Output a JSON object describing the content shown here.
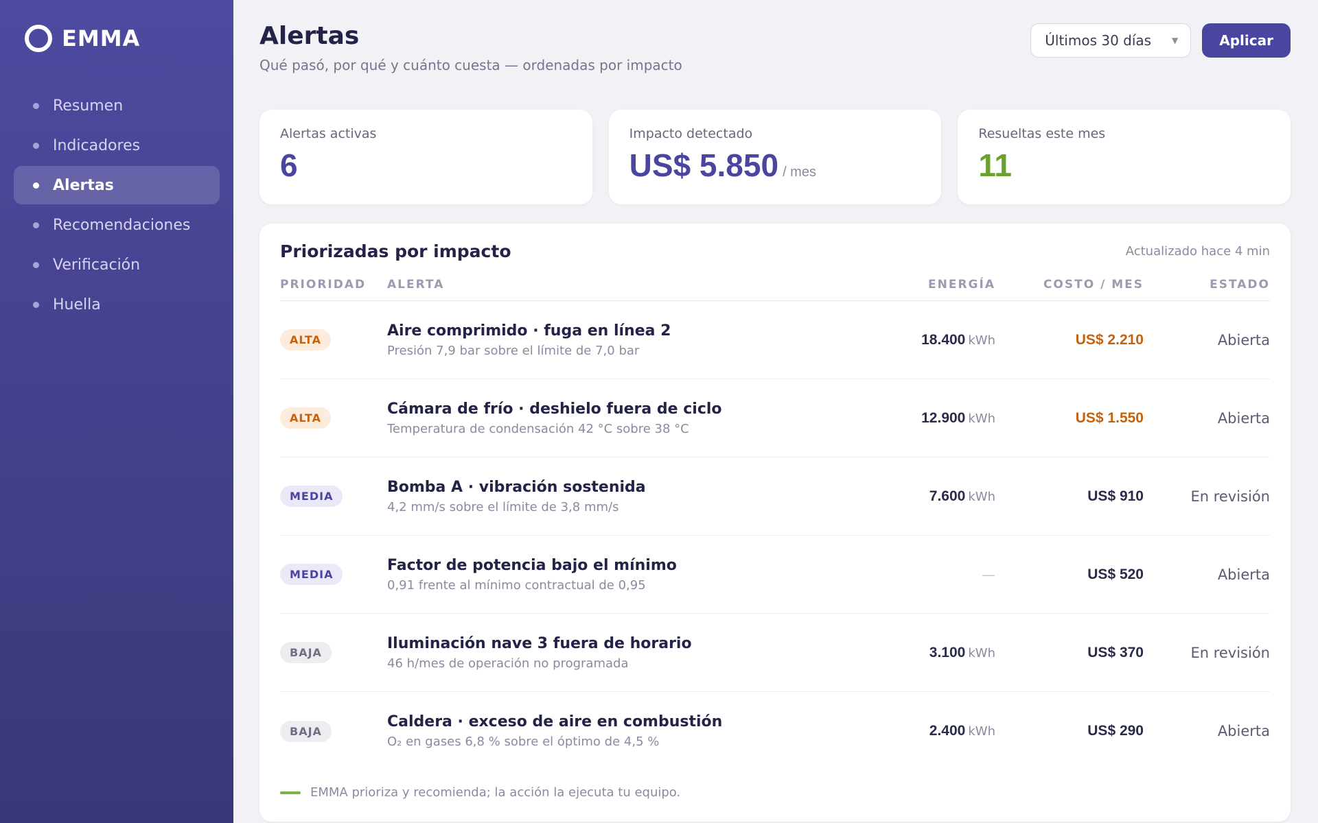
{
  "brand": {
    "name": "EMMA"
  },
  "sidebar": {
    "items": [
      {
        "label": "Resumen",
        "active": false
      },
      {
        "label": "Indicadores",
        "active": false
      },
      {
        "label": "Alertas",
        "active": true
      },
      {
        "label": "Recomendaciones",
        "active": false
      },
      {
        "label": "Verificación",
        "active": false
      },
      {
        "label": "Huella",
        "active": false
      }
    ]
  },
  "header": {
    "title": "Alertas",
    "subtitle": "Qué pasó, por qué y cuánto cuesta — ordenadas por impacto",
    "period_select": "Últimos 30 días",
    "apply_label": "Aplicar"
  },
  "kpis": {
    "active": {
      "label": "Alertas activas",
      "value": "6"
    },
    "impact": {
      "label": "Impacto detectado",
      "value": "US$ 5.850",
      "unit": "/ mes"
    },
    "resolved": {
      "label": "Resueltas este mes",
      "value": "11"
    }
  },
  "panel": {
    "title": "Priorizadas por impacto",
    "updated": "Actualizado hace 4 min",
    "columns": {
      "priority": "PRIORIDAD",
      "alert": "ALERTA",
      "energy": "ENERGÍA",
      "cost": "COSTO / MES",
      "status": "ESTADO"
    },
    "rows": [
      {
        "priority": "ALTA",
        "title": "Aire comprimido · fuga en línea 2",
        "desc": "Presión 7,9 bar sobre el límite de 7,0 bar",
        "energy": "18.400",
        "energy_unit": "kWh",
        "cost": "US$ 2.210",
        "status": "Abierta"
      },
      {
        "priority": "ALTA",
        "title": "Cámara de frío · deshielo fuera de ciclo",
        "desc": "Temperatura de condensación 42 °C sobre 38 °C",
        "energy": "12.900",
        "energy_unit": "kWh",
        "cost": "US$ 1.550",
        "status": "Abierta"
      },
      {
        "priority": "MEDIA",
        "title": "Bomba A · vibración sostenida",
        "desc": "4,2 mm/s sobre el límite de 3,8 mm/s",
        "energy": "7.600",
        "energy_unit": "kWh",
        "cost": "US$ 910",
        "status": "En revisión"
      },
      {
        "priority": "MEDIA",
        "title": "Factor de potencia bajo el mínimo",
        "desc": "0,91 frente al mínimo contractual de 0,95",
        "energy": "—",
        "energy_unit": "",
        "cost": "US$ 520",
        "status": "Abierta"
      },
      {
        "priority": "BAJA",
        "title": "Iluminación nave 3 fuera de horario",
        "desc": "46 h/mes de operación no programada",
        "energy": "3.100",
        "energy_unit": "kWh",
        "cost": "US$ 370",
        "status": "En revisión"
      },
      {
        "priority": "BAJA",
        "title": "Caldera · exceso de aire en combustión",
        "desc": "O₂ en gases 6,8 % sobre el óptimo de 4,5 %",
        "energy": "2.400",
        "energy_unit": "kWh",
        "cost": "US$ 290",
        "status": "Abierta"
      }
    ],
    "footer_note": "EMMA prioriza y recomienda; la acción la ejecuta tu equipo."
  },
  "colors": {
    "accent": "#4a46a0",
    "high": "#c4620e",
    "green": "#6aa02e"
  }
}
